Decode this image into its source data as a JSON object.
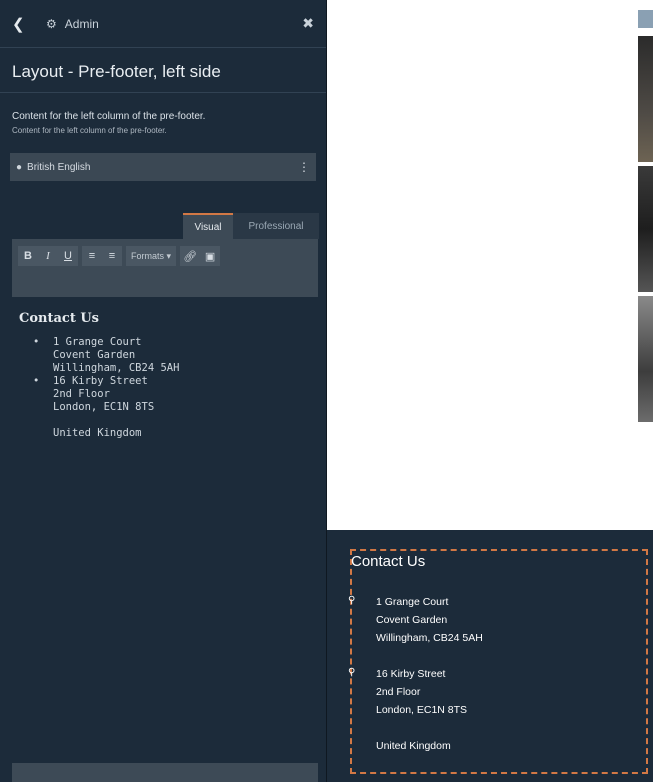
{
  "topbar": {
    "back_icon": "chevron-left-icon",
    "settings_icon": "cog-icon",
    "admin_label": "Admin",
    "close_icon": "close-icon"
  },
  "panel": {
    "title": "Layout - Pre-footer, left side",
    "description": "Content for the left column of the pre-footer.",
    "description_small": "Content for the left column of the pre-footer.",
    "language": "British English"
  },
  "tabs": {
    "visual": "Visual",
    "professional": "Professional"
  },
  "toolbar": {
    "bold": "B",
    "italic": "I",
    "underline": "U",
    "formats": "Formats"
  },
  "editor": {
    "heading": "Contact Us",
    "address1": [
      "1 Grange Court",
      "Covent Garden",
      "Willingham, CB24 5AH"
    ],
    "address2": [
      "16 Kirby Street",
      "2nd Floor",
      "London, EC1N 8TS"
    ],
    "country": "United Kingdom"
  },
  "preview": {
    "heading": "Contact Us",
    "address1": [
      "1 Grange Court",
      "Covent Garden",
      "Willingham, CB24 5AH"
    ],
    "address2": [
      "16 Kirby Street",
      "2nd Floor",
      "London, EC1N 8TS"
    ],
    "country": "United Kingdom"
  },
  "colors": {
    "panel_bg": "#1c2b3a",
    "accent": "#d27845",
    "toolbar_bg": "#3d4a56"
  }
}
